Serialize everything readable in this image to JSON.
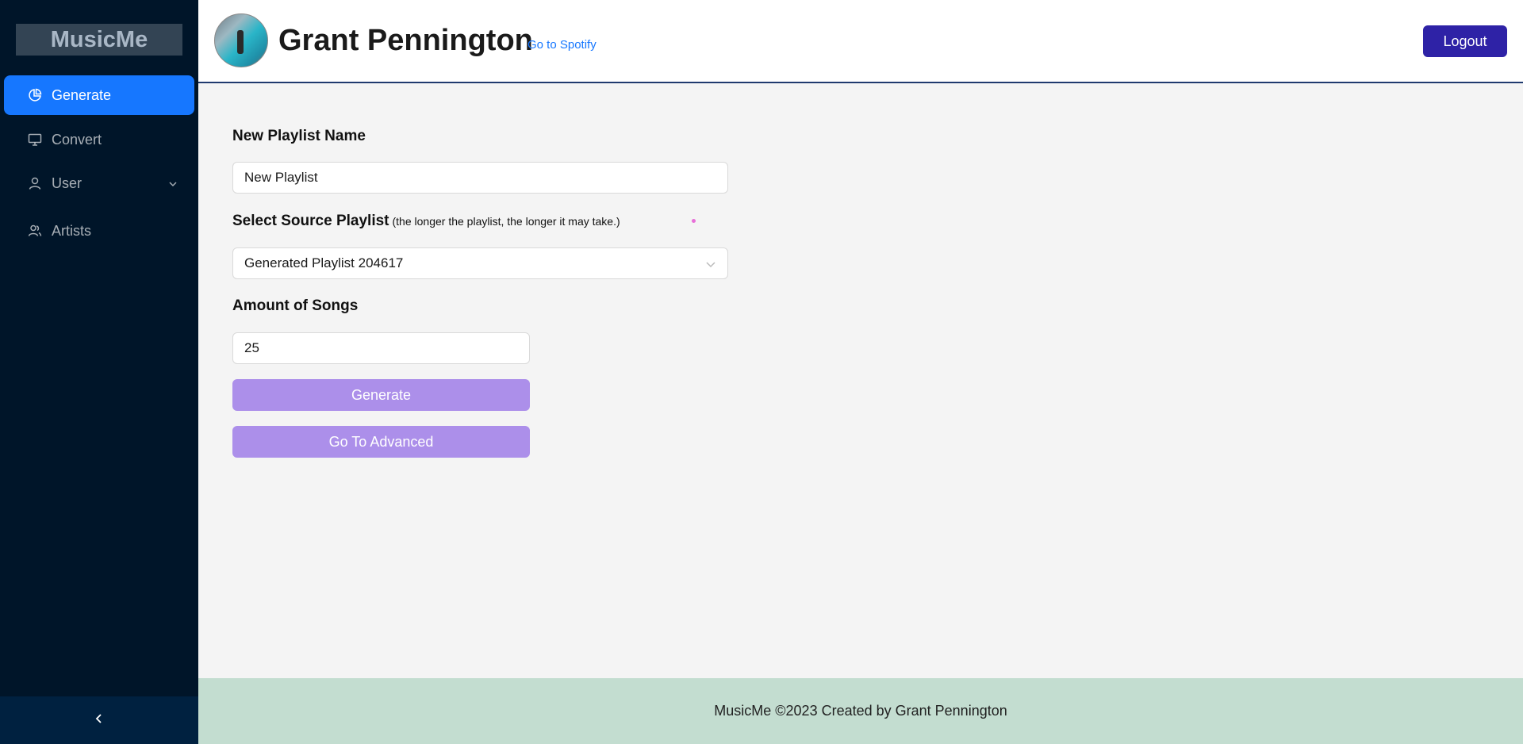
{
  "app": {
    "name": "MusicMe"
  },
  "sidebar": {
    "items": [
      {
        "label": "Generate",
        "icon": "pie-chart-icon",
        "active": true
      },
      {
        "label": "Convert",
        "icon": "desktop-icon",
        "active": false
      },
      {
        "label": "User",
        "icon": "user-icon",
        "active": false
      },
      {
        "label": "Artists",
        "icon": "team-icon",
        "active": false
      }
    ],
    "collapse_icon": "chevron-left-icon"
  },
  "header": {
    "username": "Grant Pennington",
    "spotify_link": "Go to Spotify",
    "logout_label": "Logout"
  },
  "form": {
    "name_label": "New Playlist Name",
    "name_value": "New Playlist",
    "source_label": "Select Source Playlist",
    "source_hint": "(the longer the playlist, the longer it may take.)",
    "source_value": "Generated Playlist 204617",
    "amount_label": "Amount of Songs",
    "amount_value": "25",
    "generate_label": "Generate",
    "advanced_label": "Go To Advanced"
  },
  "footer": {
    "text": "MusicMe ©2023 Created by Grant Pennington"
  },
  "colors": {
    "sidebar_bg": "#001529",
    "active_item": "#1677ff",
    "logout_bg": "#2e22a6",
    "action_button": "#ac8fea",
    "footer_bg": "#c3ddd0"
  }
}
